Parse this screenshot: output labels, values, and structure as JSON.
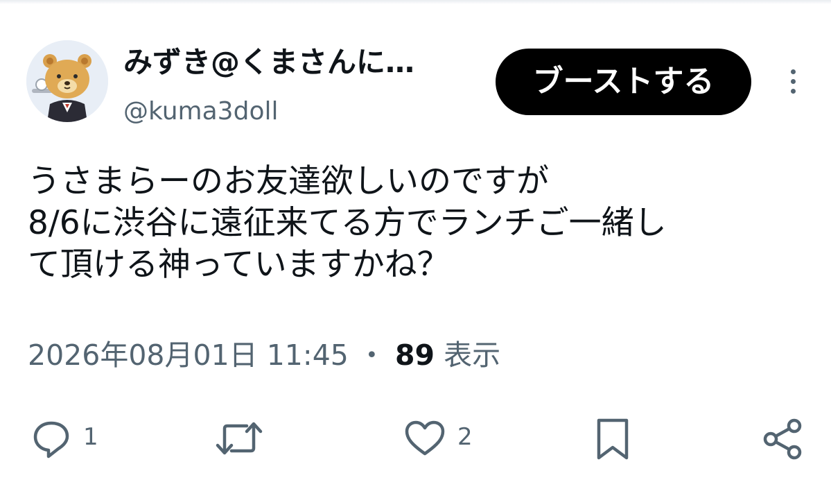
{
  "post": {
    "author": {
      "display_name": "みずき@くまさんに…",
      "handle": "@kuma3doll",
      "avatar_icon": "bear-avatar-icon"
    },
    "boost_label": "ブーストする",
    "text_lines": [
      "うさまらーのお友達欲しいのですが",
      "8/6に渋谷に遠征来てる方でランチご一緒し",
      "て頂ける神っていますかね？"
    ],
    "timestamp": "2026年08月01日 11:45",
    "separator": "・",
    "views_count": "89",
    "views_label": "表示"
  },
  "actions": {
    "reply": {
      "icon": "reply-icon",
      "count": "1"
    },
    "repost": {
      "icon": "repost-icon",
      "count": ""
    },
    "like": {
      "icon": "heart-icon",
      "count": "2"
    },
    "bookmark": {
      "icon": "bookmark-icon"
    },
    "share": {
      "icon": "share-icon"
    }
  },
  "colors": {
    "text_primary": "#0f1419",
    "text_secondary": "#536471",
    "button_bg": "#000000",
    "button_text": "#ffffff",
    "background": "#ffffff"
  }
}
